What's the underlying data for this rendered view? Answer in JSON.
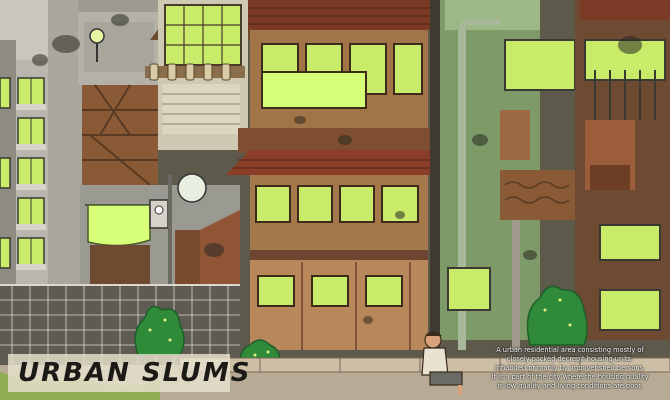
{
  "title": "URBAN SLUMS",
  "description_lines": [
    "A urban residential area consisting mostly of",
    "closely packed decrepit housing units.",
    "Inhabited primarily by impoverished persons.",
    "It is a part of the city where the housing quality",
    "is low quality and living conditions are poor."
  ],
  "colors": {
    "window_glow": "#c8ec6a",
    "wood_brown": "#8a5a36",
    "roof_red": "#7a3a26",
    "sky_green": "#9bb886",
    "concrete_grey": "#b9b6ae",
    "shrub_green": "#2f8a3a"
  },
  "icons": [
    "street-lamp-icon",
    "hanging-sheet-icon",
    "electric-meter-icon",
    "sitting-man-icon"
  ]
}
